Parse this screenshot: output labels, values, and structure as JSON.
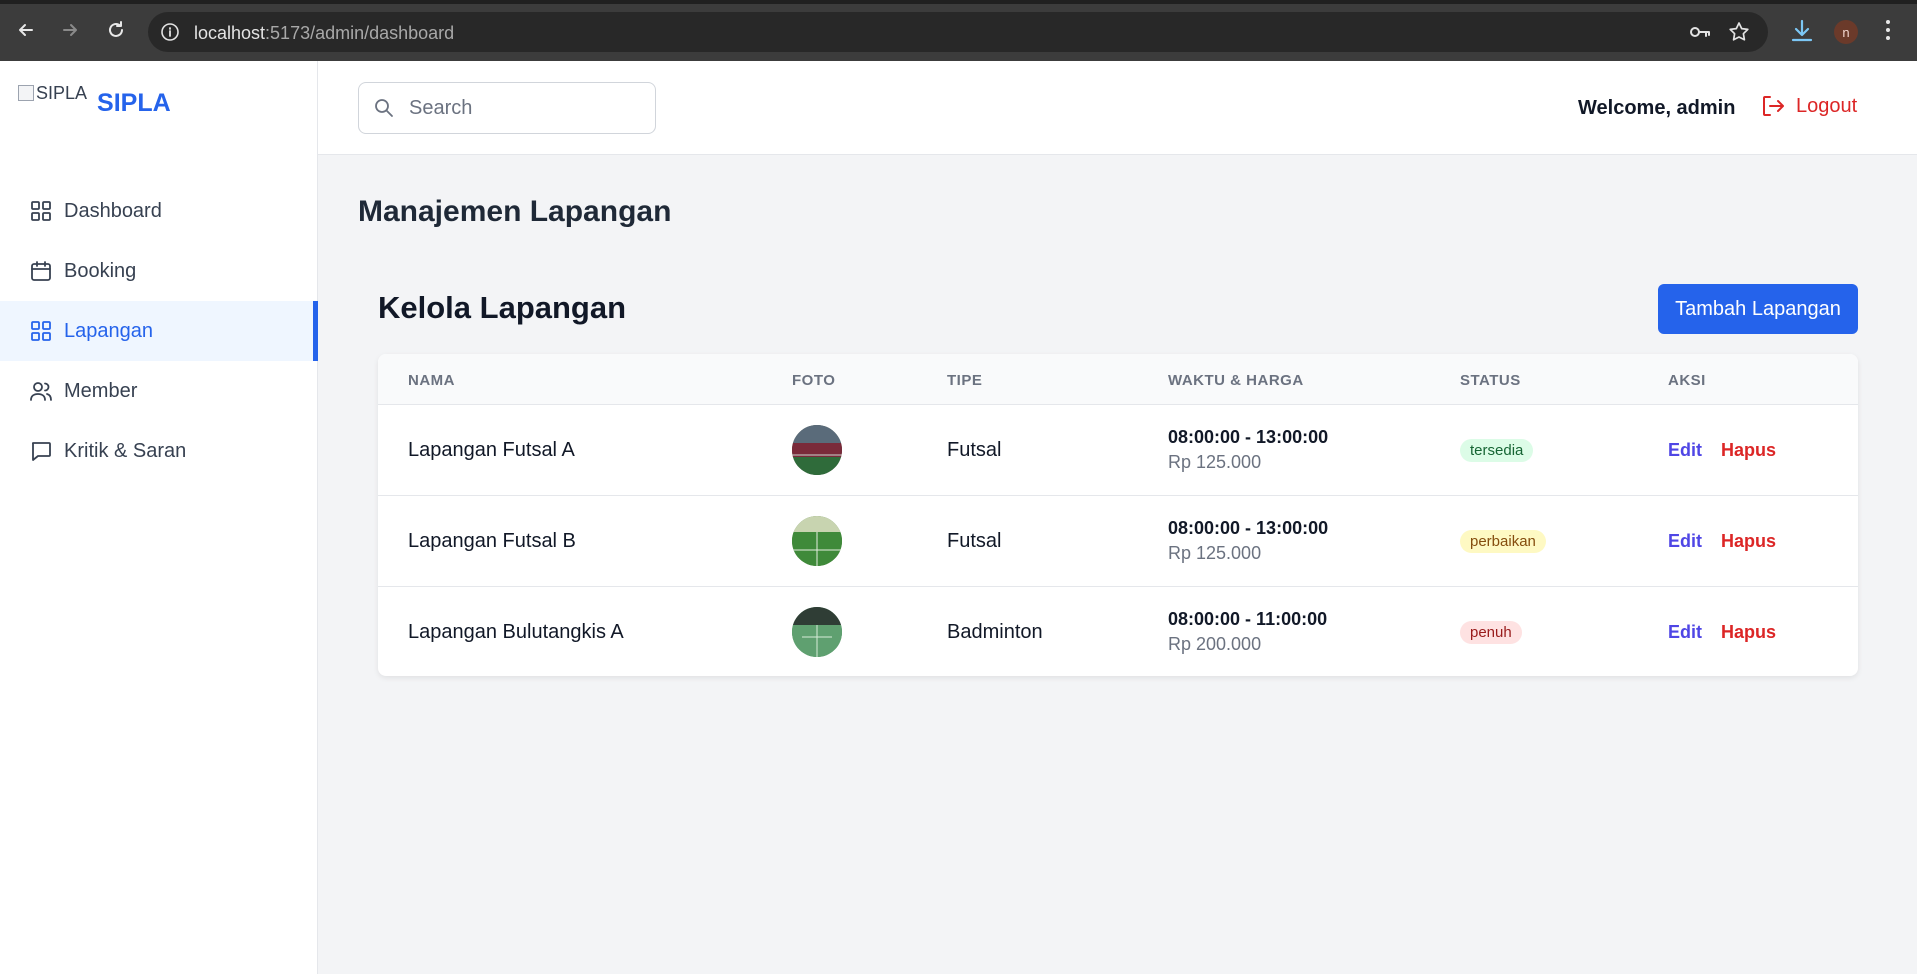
{
  "browser": {
    "url_host": "localhost",
    "url_path": ":5173/admin/dashboard",
    "profile_initial": "n"
  },
  "sidebar": {
    "logo_alt": "SIPLA",
    "brand": "SIPLA",
    "items": [
      {
        "label": "Dashboard",
        "icon": "grid-icon",
        "active": false
      },
      {
        "label": "Booking",
        "icon": "calendar-icon",
        "active": false
      },
      {
        "label": "Lapangan",
        "icon": "grid-icon",
        "active": true
      },
      {
        "label": "Member",
        "icon": "users-icon",
        "active": false
      },
      {
        "label": "Kritik & Saran",
        "icon": "message-icon",
        "active": false
      }
    ]
  },
  "header": {
    "search_placeholder": "Search",
    "welcome": "Welcome, admin",
    "logout": "Logout"
  },
  "main": {
    "page_title": "Manajemen Lapangan",
    "section_title": "Kelola Lapangan",
    "add_button": "Tambah Lapangan",
    "columns": [
      "NAMA",
      "FOTO",
      "TIPE",
      "WAKTU & HARGA",
      "STATUS",
      "AKSI"
    ],
    "rows": [
      {
        "nama": "Lapangan Futsal A",
        "tipe": "Futsal",
        "waktu": "08:00:00 - 13:00:00",
        "harga": "Rp 125.000",
        "status": "tersedia",
        "edit": "Edit",
        "hapus": "Hapus"
      },
      {
        "nama": "Lapangan Futsal B",
        "tipe": "Futsal",
        "waktu": "08:00:00 - 13:00:00",
        "harga": "Rp 125.000",
        "status": "perbaikan",
        "edit": "Edit",
        "hapus": "Hapus"
      },
      {
        "nama": "Lapangan Bulutangkis A",
        "tipe": "Badminton",
        "waktu": "08:00:00 - 11:00:00",
        "harga": "Rp 200.000",
        "status": "penuh",
        "edit": "Edit",
        "hapus": "Hapus"
      }
    ]
  },
  "colors": {
    "accent": "#2563eb",
    "danger": "#dc2626",
    "status_tersedia": "#dcfce7",
    "status_perbaikan": "#fef9c3",
    "status_penuh": "#fee2e2"
  }
}
